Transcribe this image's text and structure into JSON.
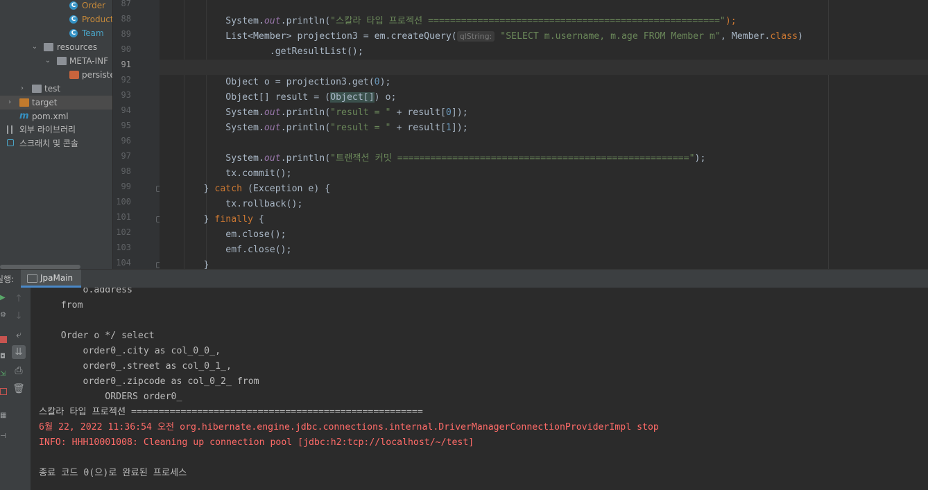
{
  "project_tree": {
    "items": [
      {
        "label": "Order",
        "kind": "class",
        "indent": 3
      },
      {
        "label": "Product",
        "kind": "class",
        "indent": 3
      },
      {
        "label": "Team",
        "kind": "class",
        "indent": 3
      },
      {
        "label": "resources",
        "kind": "folder",
        "indent": 2
      },
      {
        "label": "META-INF",
        "kind": "folder",
        "indent": 3
      },
      {
        "label": "persister",
        "kind": "xml",
        "indent": 4
      },
      {
        "label": "test",
        "kind": "folder",
        "indent": 1
      },
      {
        "label": "target",
        "kind": "folder-orange",
        "indent": 0
      },
      {
        "label": "pom.xml",
        "kind": "maven",
        "indent": 1
      },
      {
        "label": "외부 라이브러리",
        "kind": "libraries",
        "indent": 0
      },
      {
        "label": "스크래치 및 콘솔",
        "kind": "scratch",
        "indent": 0
      }
    ]
  },
  "editor": {
    "line_numbers": [
      "87",
      "88",
      "89",
      "90",
      "91",
      "92",
      "93",
      "94",
      "95",
      "96",
      "97",
      "98",
      "99",
      "100",
      "101",
      "102",
      "103",
      "104"
    ],
    "current_line": "91",
    "param_hint": "qlString:",
    "lines": {
      "l88_a": "            System.",
      "l88_out": "out",
      "l88_b": ".println(",
      "l88_str": "\"스칼라 타입 프로젝션 =====================================================\"",
      "l88_c": ");",
      "l89_a": "            List<Member> projection3 = em.createQuery(",
      "l89_str": "\"SELECT m.username, m.age FROM Member m\"",
      "l89_b": ", Member.",
      "l89_kw": "class",
      "l89_c": ")",
      "l90": "                    .getResultList();",
      "l92_a": "            Object o = projection3.get(",
      "l92_num": "0",
      "l92_b": ");",
      "l93_a": "            Object[] result = (",
      "l93_hl": "Object[]",
      "l93_b": ") o;",
      "l94_a": "            System.",
      "l94_out": "out",
      "l94_b": ".println(",
      "l94_str": "\"result = \"",
      "l94_c": " + result[",
      "l94_num": "0",
      "l94_d": "]);",
      "l95_a": "            System.",
      "l95_out": "out",
      "l95_b": ".println(",
      "l95_str": "\"result = \"",
      "l95_c": " + result[",
      "l95_num": "1",
      "l95_d": "]);",
      "l97_a": "            System.",
      "l97_out": "out",
      "l97_b": ".println(",
      "l97_str": "\"트랜잭션 커밋 =====================================================\"",
      "l97_c": ");",
      "l98": "            tx.commit();",
      "l99_a": "        } ",
      "l99_kw": "catch",
      "l99_b": " (Exception e) {",
      "l100": "            tx.rollback();",
      "l101_a": "        } ",
      "l101_kw": "finally",
      "l101_b": " {",
      "l102": "            em.close();",
      "l103": "            emf.close();",
      "l104": "        }"
    }
  },
  "run_panel": {
    "label": "실행:",
    "tab_label": "JpaMain",
    "output": [
      {
        "text": "        o.address",
        "type": "normal"
      },
      {
        "text": "    from",
        "type": "normal"
      },
      {
        "text": "",
        "type": "normal"
      },
      {
        "text": "    Order o */ select",
        "type": "normal"
      },
      {
        "text": "        order0_.city as col_0_0_,",
        "type": "normal"
      },
      {
        "text": "        order0_.street as col_0_1_,",
        "type": "normal"
      },
      {
        "text": "        order0_.zipcode as col_0_2_ from",
        "type": "normal"
      },
      {
        "text": "            ORDERS order0_",
        "type": "normal"
      },
      {
        "text": "스칼라 타입 프로젝션 =====================================================",
        "type": "normal"
      },
      {
        "text": "6월 22, 2022 11:36:54 오전 org.hibernate.engine.jdbc.connections.internal.DriverManagerConnectionProviderImpl stop",
        "type": "error"
      },
      {
        "text": "INFO: HHH10001008: Cleaning up connection pool [jdbc:h2:tcp://localhost/~/test]",
        "type": "error"
      },
      {
        "text": "",
        "type": "normal"
      },
      {
        "text": "종료 코드 0(으)로 완료된 프로세스",
        "type": "normal"
      }
    ]
  },
  "colors": {
    "keyword": "#cc7832",
    "string": "#6a8759",
    "number": "#6897bb",
    "static_field": "#9876aa",
    "error_text": "#ff6b68",
    "tab_accent": "#4a88c7"
  }
}
